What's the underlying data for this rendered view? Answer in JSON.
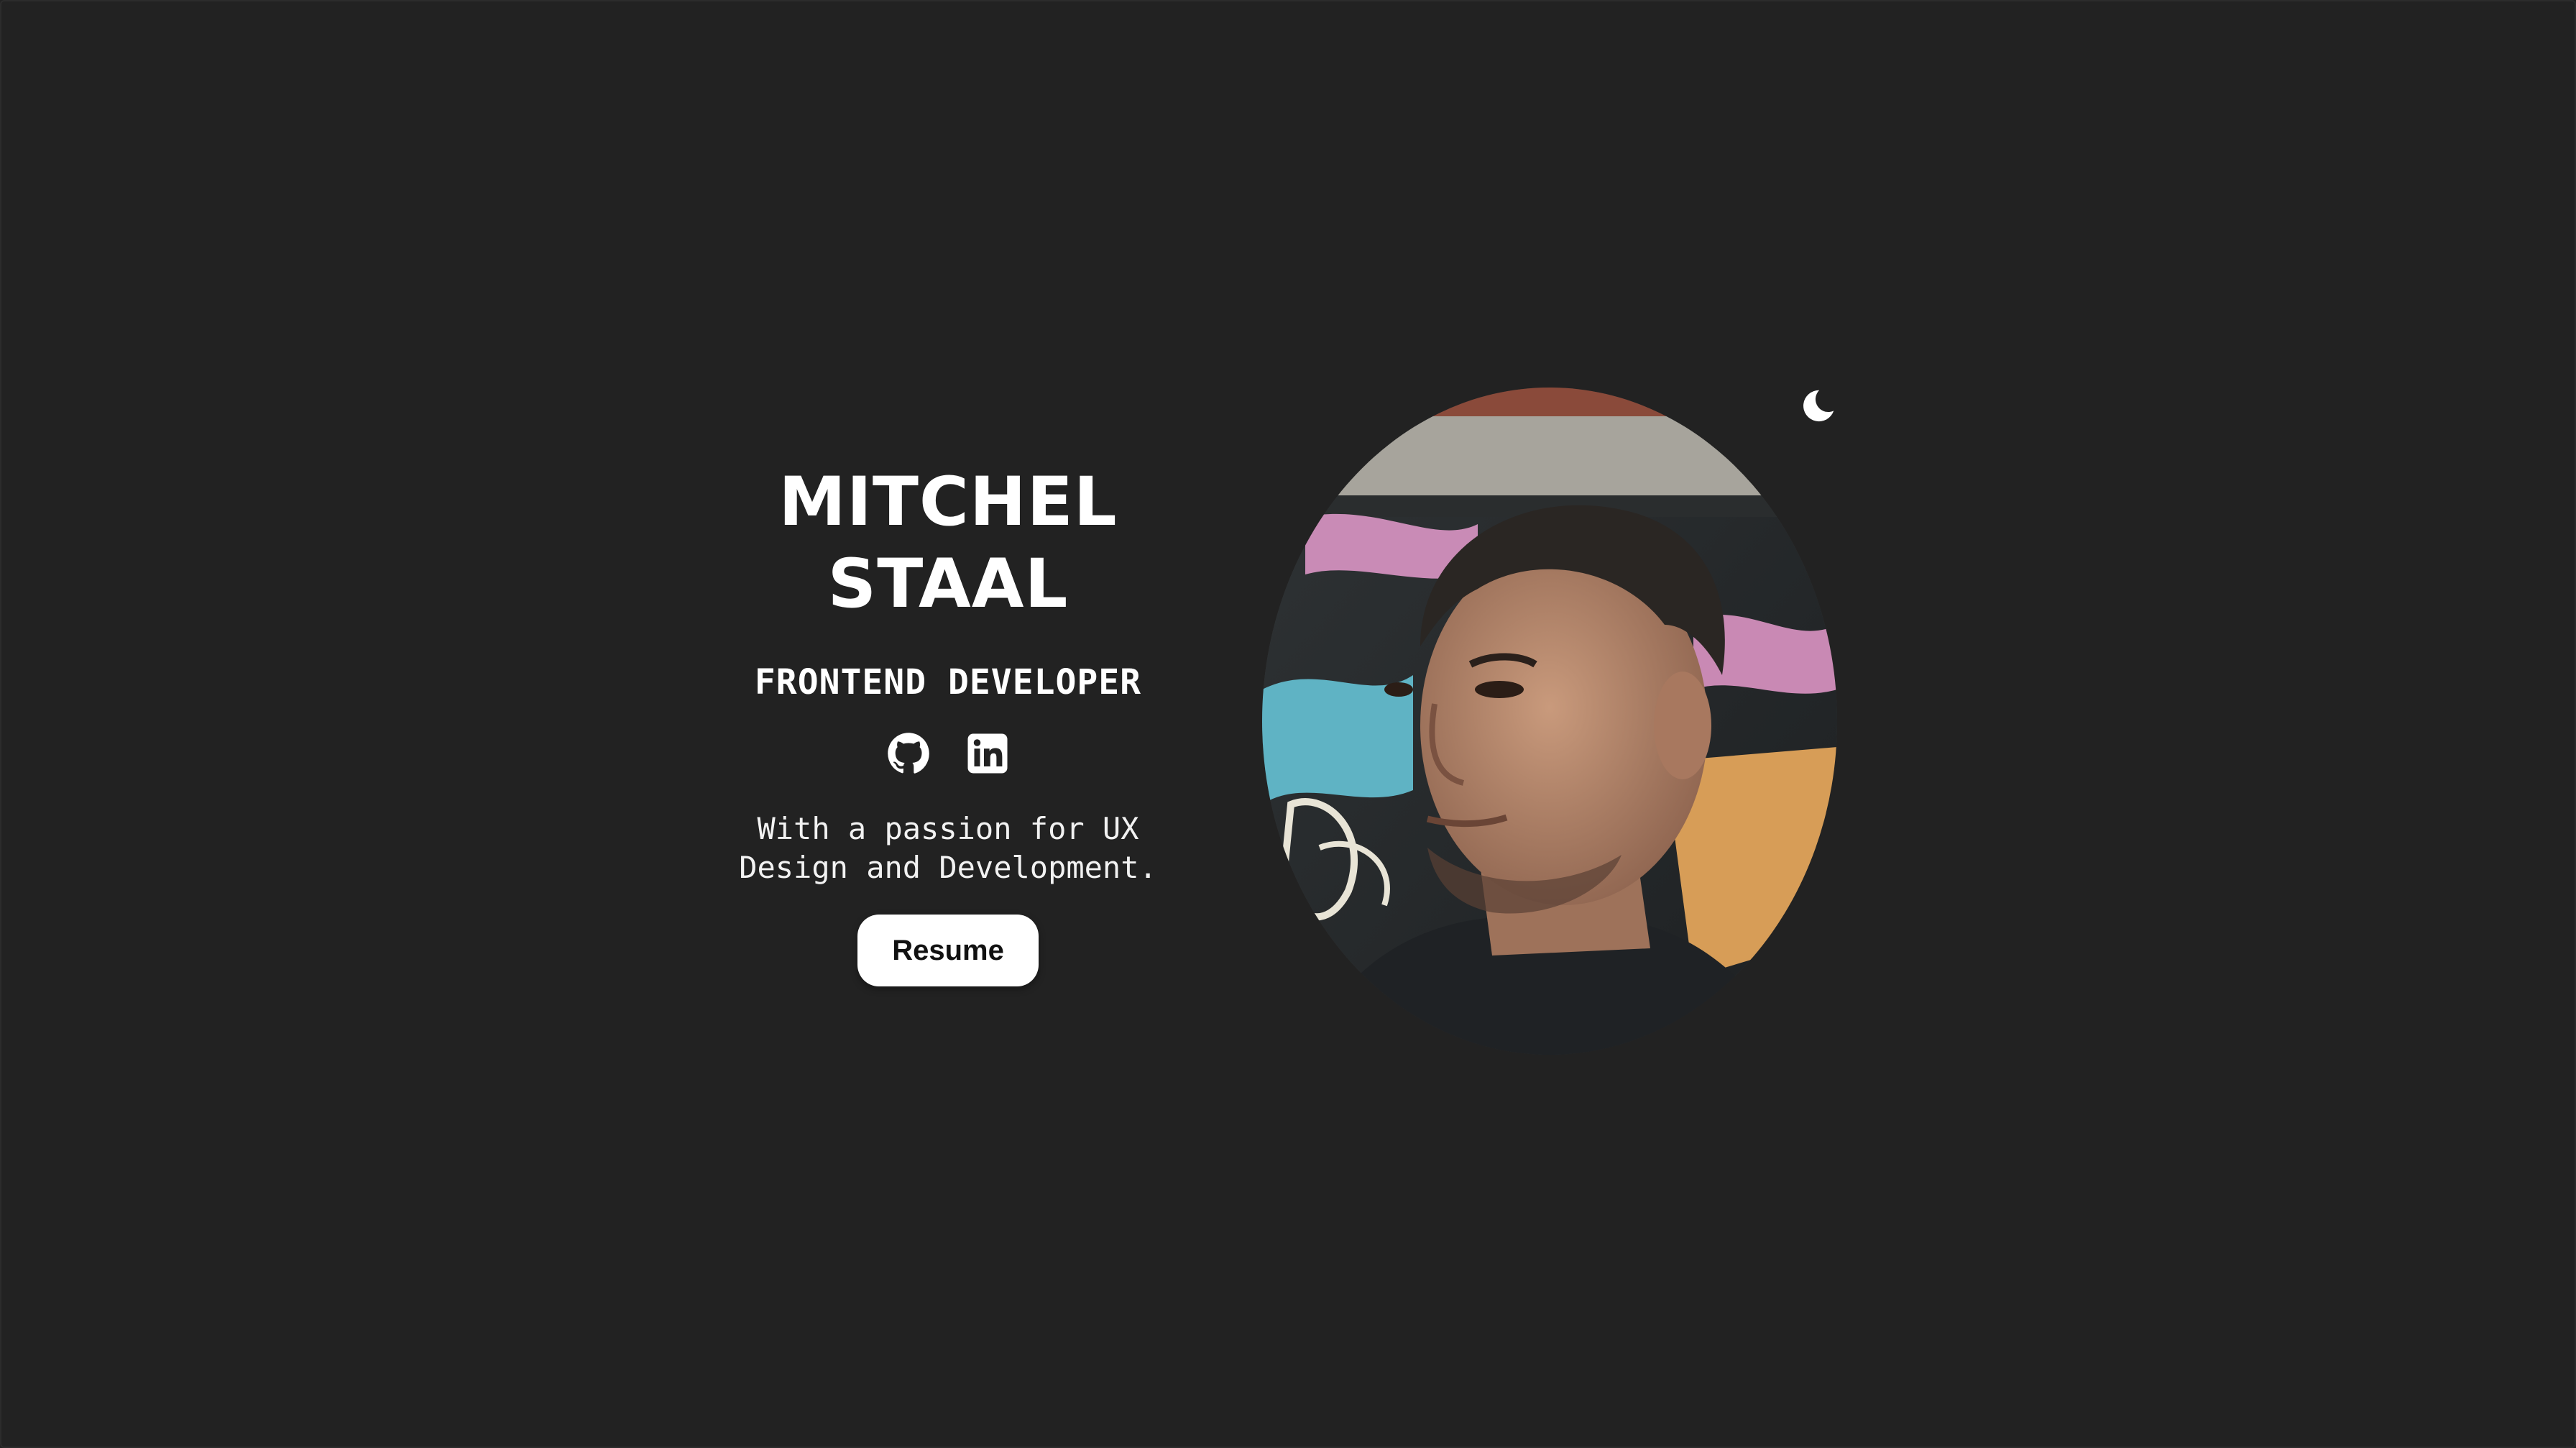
{
  "hero": {
    "name_line_1": "MITCHEL",
    "name_line_2": "STAAL",
    "role": "FRONTEND DEVELOPER",
    "tagline_line_1": "With a passion for UX",
    "tagline_line_2": "Design and Development.",
    "resume_label": "Resume"
  },
  "socials": [
    {
      "icon": "github-icon"
    },
    {
      "icon": "linkedin-icon"
    }
  ],
  "theme_toggle": {
    "icon": "moon-icon"
  },
  "colors": {
    "background": "#222222",
    "text": "#ffffff",
    "button_bg": "#ffffff",
    "button_text": "#111111"
  }
}
